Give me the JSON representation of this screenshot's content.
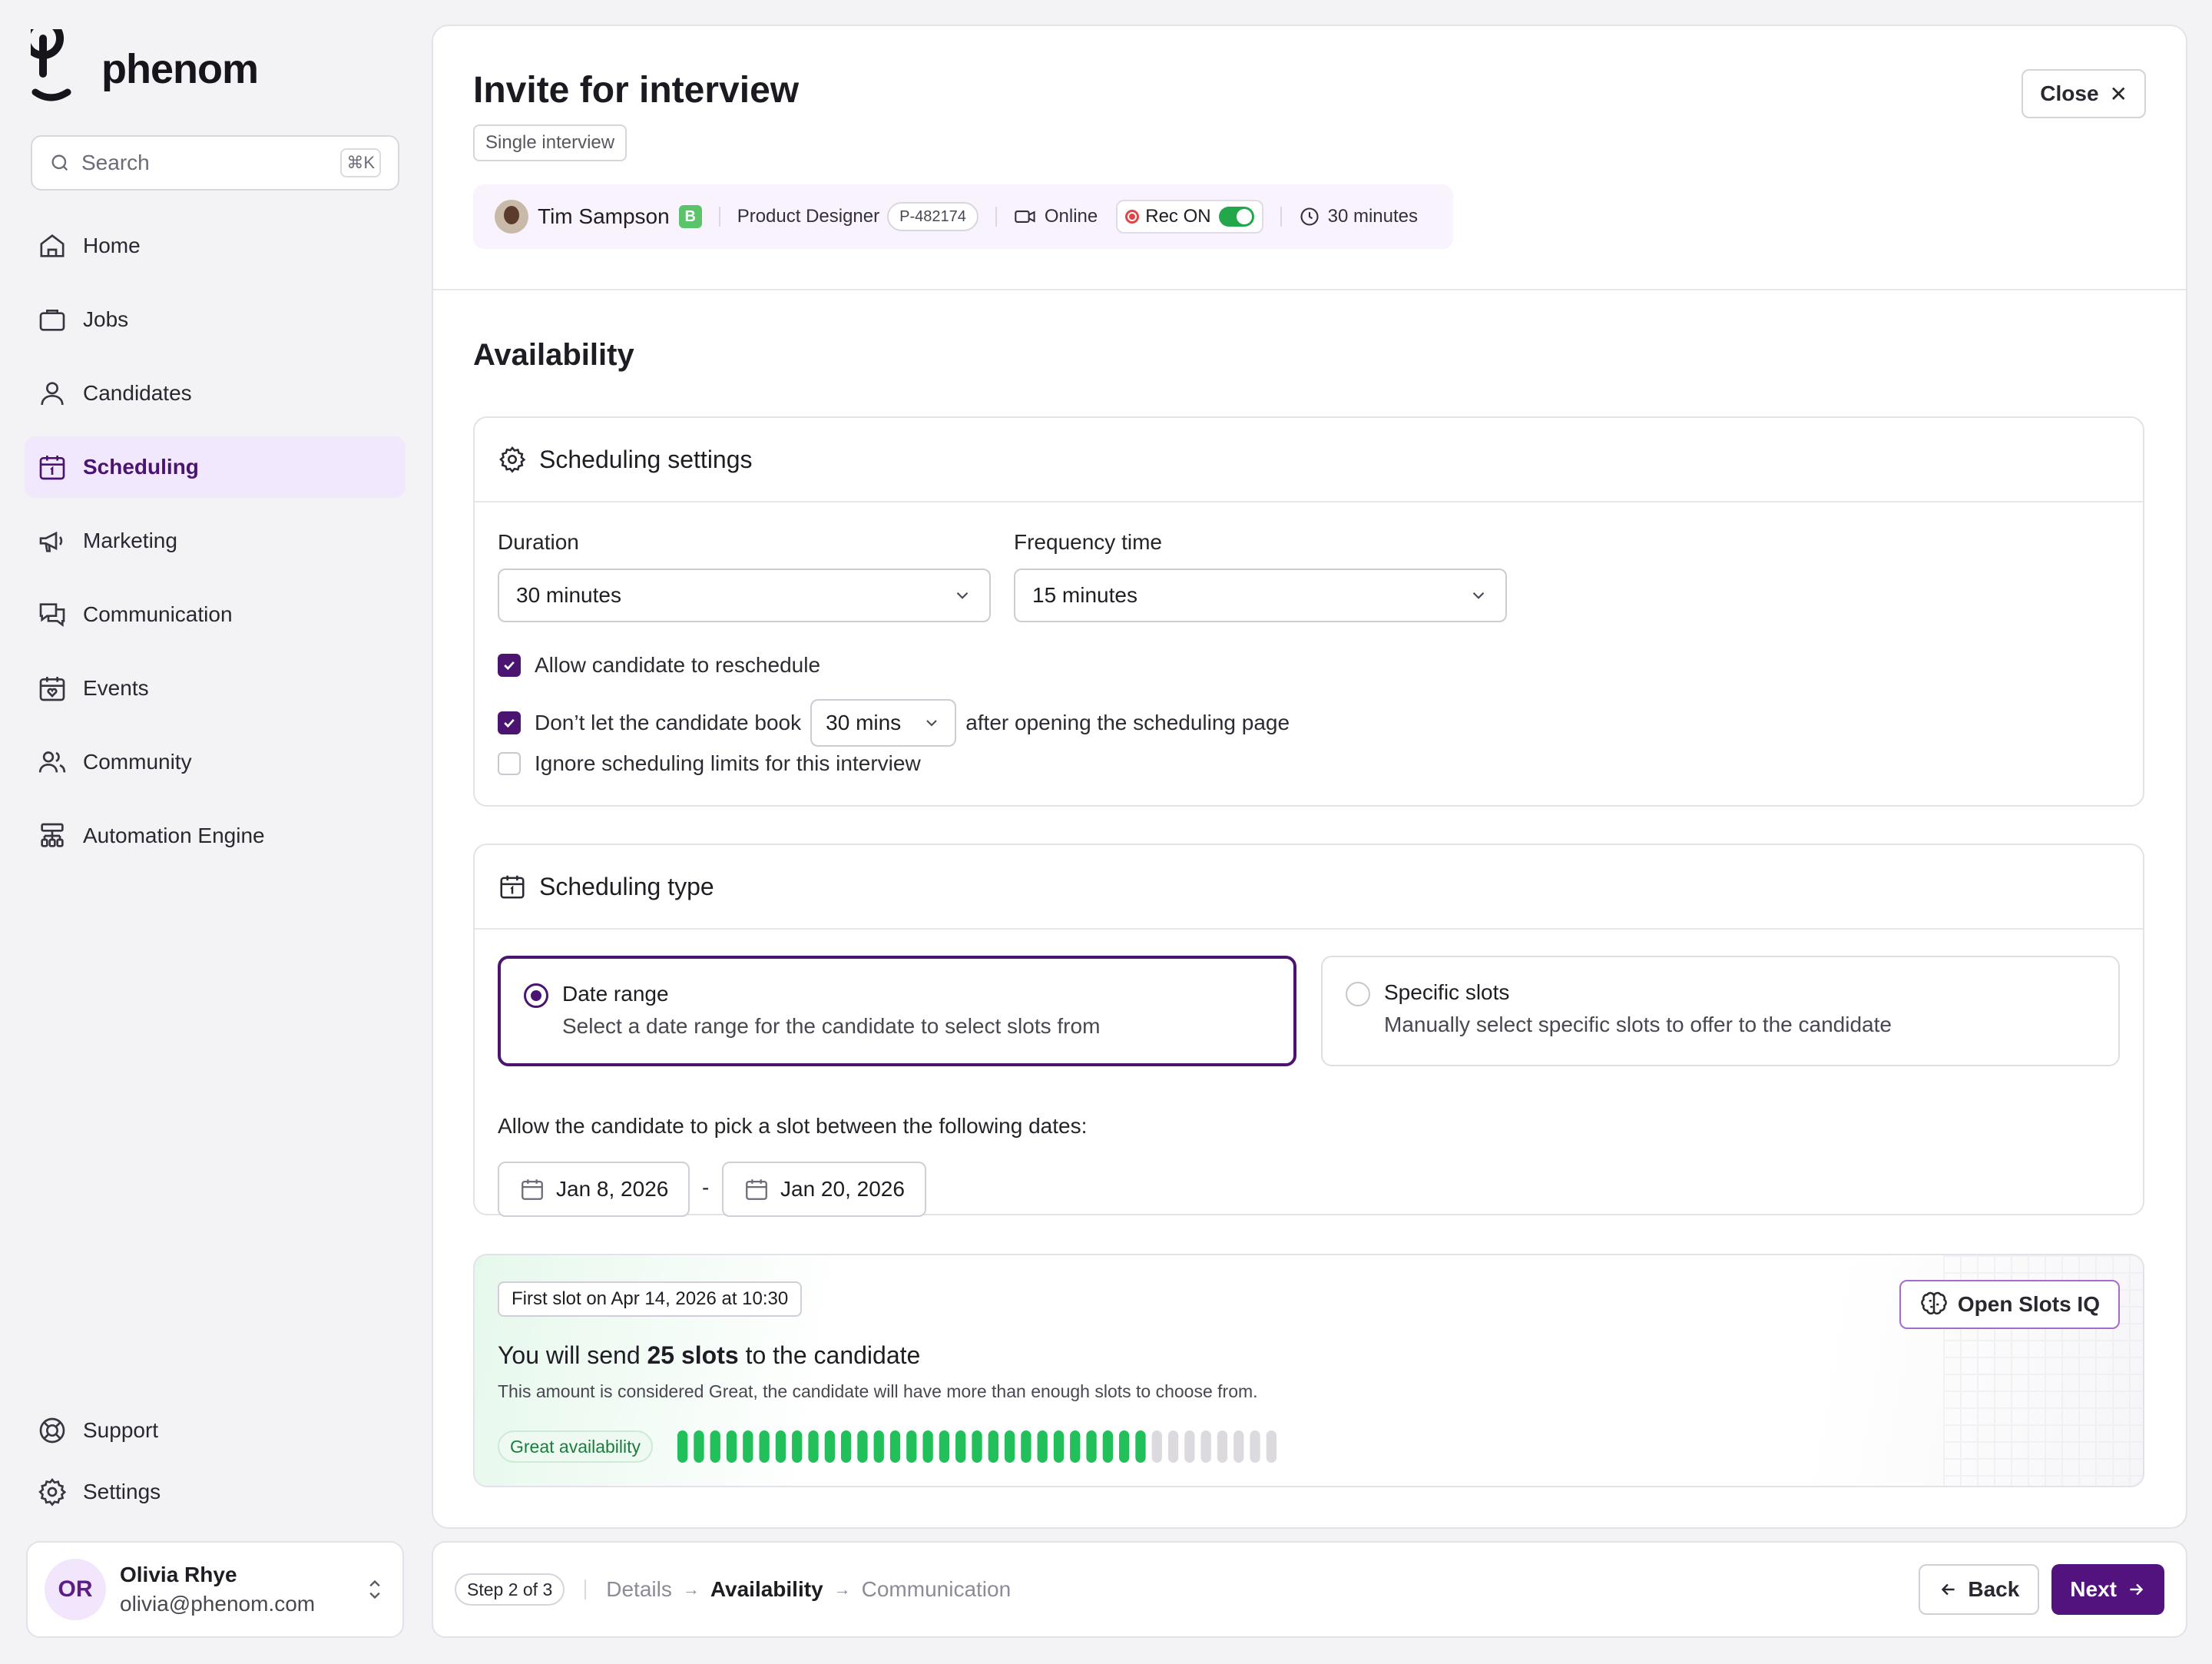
{
  "app": {
    "brand": "phenom"
  },
  "search": {
    "placeholder": "Search",
    "shortcut": "⌘K"
  },
  "sidebar": {
    "items": [
      {
        "label": "Home",
        "icon": "home-icon"
      },
      {
        "label": "Jobs",
        "icon": "briefcase-icon"
      },
      {
        "label": "Candidates",
        "icon": "user-icon"
      },
      {
        "label": "Scheduling",
        "icon": "calendar-icon",
        "active": true
      },
      {
        "label": "Marketing",
        "icon": "megaphone-icon"
      },
      {
        "label": "Communication",
        "icon": "chat-icon"
      },
      {
        "label": "Events",
        "icon": "calendar-heart-icon"
      },
      {
        "label": "Community",
        "icon": "users-icon"
      },
      {
        "label": "Automation Engine",
        "icon": "workflow-icon"
      }
    ],
    "bottom": [
      {
        "label": "Support",
        "icon": "lifebuoy-icon"
      },
      {
        "label": "Settings",
        "icon": "gear-icon"
      }
    ]
  },
  "user": {
    "initials": "OR",
    "name": "Olivia Rhye",
    "email": "olivia@phenom.com"
  },
  "header": {
    "title": "Invite for interview",
    "type_chip": "Single interview",
    "close_label": "Close"
  },
  "candidate": {
    "name": "Tim Sampson",
    "badge": "B",
    "role": "Product Designer",
    "id": "P-482174",
    "mode": "Online",
    "rec_label": "Rec ON",
    "rec_on": true,
    "duration": "30 minutes"
  },
  "availability": {
    "title": "Availability"
  },
  "scheduling_settings": {
    "title": "Scheduling settings",
    "duration_label": "Duration",
    "duration_value": "30 minutes",
    "frequency_label": "Frequency time",
    "frequency_value": "15 minutes",
    "reschedule_label": "Allow candidate to reschedule",
    "reschedule_checked": true,
    "book_prefix": "Don’t let the candidate book",
    "book_value": "30 mins",
    "book_suffix": "after opening the scheduling page",
    "book_checked": true,
    "ignore_label": "Ignore scheduling limits for this interview",
    "ignore_checked": false
  },
  "scheduling_type": {
    "title": "Scheduling type",
    "options": [
      {
        "title": "Date range",
        "desc": "Select a date range for the candidate to select slots from",
        "selected": true
      },
      {
        "title": "Specific slots",
        "desc": "Manually select specific slots to offer to the candidate",
        "selected": false
      }
    ],
    "range_label": "Allow the candidate to pick a slot between the following dates:",
    "start_date": "Jan 8, 2026",
    "range_sep": "-",
    "end_date": "Jan 20, 2026"
  },
  "slots": {
    "first_slot": "First slot on Apr 14, 2026 at 10:30",
    "line_prefix": "You will send",
    "line_count": "25 slots",
    "line_suffix": "to the candidate",
    "sub": "This amount is considered Great, the candidate will have more than enough slots to choose from.",
    "badge": "Great availability",
    "bars_filled": 29,
    "bars_total": 37,
    "open_label": "Open Slots IQ"
  },
  "footer": {
    "step": "Step 2 of 3",
    "steps": [
      "Details",
      "Availability",
      "Communication"
    ],
    "current_step": 1,
    "back_label": "Back",
    "next_label": "Next"
  },
  "colors": {
    "accent": "#4a1470",
    "bar_on": "#22c05a",
    "bar_off": "#dcdadf"
  }
}
